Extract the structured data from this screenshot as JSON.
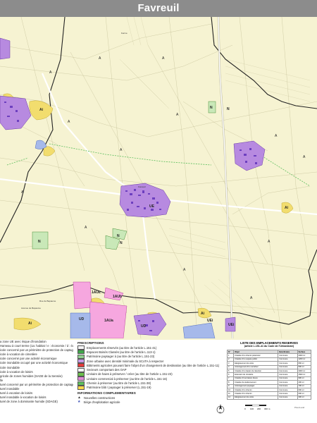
{
  "title": "Favreuil",
  "map": {
    "zone_labels": [
      "Ai",
      "A",
      "N",
      "UE",
      "UD",
      "1AUe",
      "1AUa",
      "1AUb",
      "UEi",
      "N",
      "Ai",
      "Ai",
      "A",
      "A",
      "N",
      "A",
      "A",
      "A",
      "A",
      "A",
      "A",
      "A",
      "N",
      "Ai",
      "A",
      "N",
      "UD",
      "UEi",
      "A",
      "A"
    ],
    "place_names": [
      "Favreuil",
      "Ferme",
      "Rue de Bapaume",
      "Avenue de Bapaume"
    ],
    "colors": {
      "agricultural": "#f6f3d2",
      "urban": "#8a5ac9",
      "urban_light": "#b78ae0",
      "natural": "#c9e8b8",
      "flood": "#f2dd6e",
      "activity": "#f6a7df",
      "blue_zone": "#a6b9ea",
      "road": "#ffffff",
      "border": "#222222"
    }
  },
  "legend_left": {
    "items": [
      "a zone UE avec risque d'inondation",
      "Hameau à court terme (1a: habitat / e : économie / d : équipement)",
      "",
      "icole concerné par un périmètre de protection de captage",
      "icole à vocation de cimetière",
      "icole concerné par une activité économique",
      "icole inondable occupé par une activité économique",
      "icole inondable",
      "icole à vocation de loisirs",
      "gricole de zones humides (SAGE de la Sensée)",
      "lle",
      "turel concerné par un périmètre de protection de captage",
      "turel inondable",
      "turel à vocation de loisirs",
      "turel inondable à vocation de loisirs",
      "turel de zone à dominante humide (SDAGE)"
    ]
  },
  "legend_mid": {
    "prescriptions_title": "PRESCRIPTIONS",
    "prescriptions": [
      {
        "text": "Emplacements réservés (au titre de l'article L.151-41)",
        "color": "#f4f4f4"
      },
      {
        "text": "Espaces Boisés Classés (au titre de l'article L.113-1)",
        "color": "#3fa64a"
      },
      {
        "text": "Patrimoine paysager à (au titre de l'article L.151-23)",
        "color": "#8fd08f"
      },
      {
        "text": "Zone urbaine avec densité minimale du SCoTA à respecter",
        "color": "#c79be8"
      },
      {
        "text": "Bâtiments agricoles pouvant faire l'objet d'un changement de destination (au titre de l'article L.151-11)",
        "color": "#e33a3a"
      },
      {
        "text": "Secteurs comportant des OAP",
        "color": "#f6f6f6"
      },
      {
        "text": "Linéaire de haies à préserver / créer (au titre de l'article L.151-23)",
        "color": "#6abf4b"
      },
      {
        "text": "Linéaire commercial à préserver (au titre de l'article L.151-16)",
        "color": "#e08ad6"
      },
      {
        "text": "Chemin à préserver (au titre de l'article L.151-38)",
        "color": "#5fbf5f"
      },
      {
        "text": "Patrimoine bâti / paysager à préserver (L.151-19)",
        "color": "#ffd84a"
      }
    ],
    "info_title": "INFORMATIONS COMPLEMENTAIRES",
    "info": [
      {
        "text": "Nouvelles constructions",
        "icon": "triangle-icon"
      },
      {
        "text": "Siège d'exploitation agricole",
        "icon": "star-icon"
      }
    ]
  },
  "legend_right": {
    "title": "LISTE DES EMPLACEMENTS RESERVES",
    "subtitle": "(article L.151-41 du Code de l'Urbanisme)",
    "columns": [
      "N°",
      "Objet",
      "Bénéficiaire",
      "Surface"
    ],
    "rows": [
      [
        "1",
        "Création d'un chemin piétonnier",
        "Commune",
        "2000 m²"
      ],
      [
        "2",
        "Création d'un espace public",
        "Commune",
        "1200 m²"
      ],
      [
        "3",
        "Elargissement de voirie",
        "Commune",
        "800 m²"
      ],
      [
        "4",
        "Aménagement d'un carrefour",
        "Commune",
        "500 m²"
      ],
      [
        "5",
        "Création d'un bassin de rétention",
        "Commune",
        "3000 m²"
      ],
      [
        "6",
        "Extension du cimetière",
        "Commune",
        "1500 m²"
      ],
      [
        "7",
        "Création d'une liaison douce",
        "Commune",
        "900 m²"
      ],
      [
        "8",
        "Création de stationnement",
        "Commune",
        "400 m²"
      ],
      [
        "9",
        "Aménagement paysager",
        "Commune",
        "700 m²"
      ],
      [
        "10",
        "Création d'un chemin",
        "Commune",
        "600 m²"
      ],
      [
        "11",
        "Création d'un chemin",
        "Commune",
        "600 m²"
      ],
      [
        "12",
        "Elargissement de voirie",
        "Commune",
        "300 m²"
      ]
    ]
  },
  "scale": {
    "labels": [
      "0",
      "100",
      "200",
      "300 m"
    ]
  },
  "north_label": "N",
  "credit": "Pixel-Land"
}
